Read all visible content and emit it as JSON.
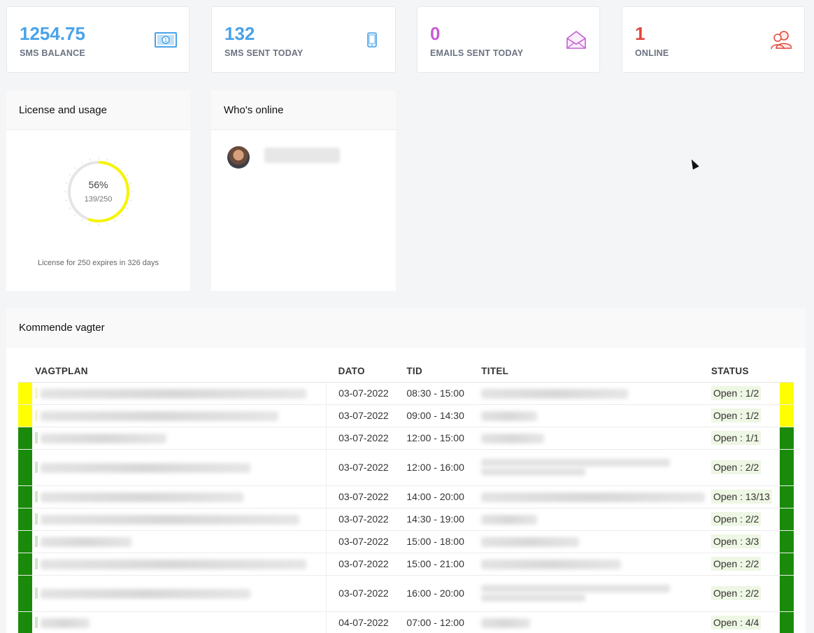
{
  "stats": [
    {
      "value": "1254.75",
      "label": "SMS BALANCE",
      "color": "#4aa3e8",
      "icon": "money-bill-icon"
    },
    {
      "value": "132",
      "label": "SMS SENT TODAY",
      "color": "#4aa3e8",
      "icon": "mobile-phone-icon"
    },
    {
      "value": "0",
      "label": "EMAILS SENT TODAY",
      "color": "#c55fd3",
      "icon": "envelope-open-icon"
    },
    {
      "value": "1",
      "label": "ONLINE",
      "color": "#e0473b",
      "icon": "users-icon"
    }
  ],
  "license": {
    "title": "License and usage",
    "percent_label": "56%",
    "count_label": "139/250",
    "fraction": 0.556,
    "ring_color": "#f5f500",
    "note": "License for 250 expires in 326 days"
  },
  "online": {
    "title": "Who's online"
  },
  "shifts": {
    "title": "Kommende vagter",
    "columns": {
      "plan": "VAGTPLAN",
      "date": "DATO",
      "time": "TID",
      "title": "TITEL",
      "status": "STATUS"
    },
    "rows": [
      {
        "date": "03-07-2022",
        "time": "08:30 - 15:00",
        "status": "Open : 1/2",
        "color": "#ffff00",
        "tall": false
      },
      {
        "date": "03-07-2022",
        "time": "09:00 - 14:30",
        "status": "Open : 1/2",
        "color": "#ffff00",
        "tall": false
      },
      {
        "date": "03-07-2022",
        "time": "12:00 - 15:00",
        "status": "Open : 1/1",
        "color": "#1a8a0a",
        "tall": false
      },
      {
        "date": "03-07-2022",
        "time": "12:00 - 16:00",
        "status": "Open : 2/2",
        "color": "#1a8a0a",
        "tall": true
      },
      {
        "date": "03-07-2022",
        "time": "14:00 - 20:00",
        "status": "Open : 13/13",
        "color": "#1a8a0a",
        "tall": false
      },
      {
        "date": "03-07-2022",
        "time": "14:30 - 19:00",
        "status": "Open : 2/2",
        "color": "#1a8a0a",
        "tall": false
      },
      {
        "date": "03-07-2022",
        "time": "15:00 - 18:00",
        "status": "Open : 3/3",
        "color": "#1a8a0a",
        "tall": false
      },
      {
        "date": "03-07-2022",
        "time": "15:00 - 21:00",
        "status": "Open : 2/2",
        "color": "#1a8a0a",
        "tall": false
      },
      {
        "date": "03-07-2022",
        "time": "16:00 - 20:00",
        "status": "Open : 2/2",
        "color": "#1a8a0a",
        "tall": true
      },
      {
        "date": "04-07-2022",
        "time": "07:00 - 12:00",
        "status": "Open : 4/4",
        "color": "#1a8a0a",
        "tall": false
      }
    ]
  }
}
